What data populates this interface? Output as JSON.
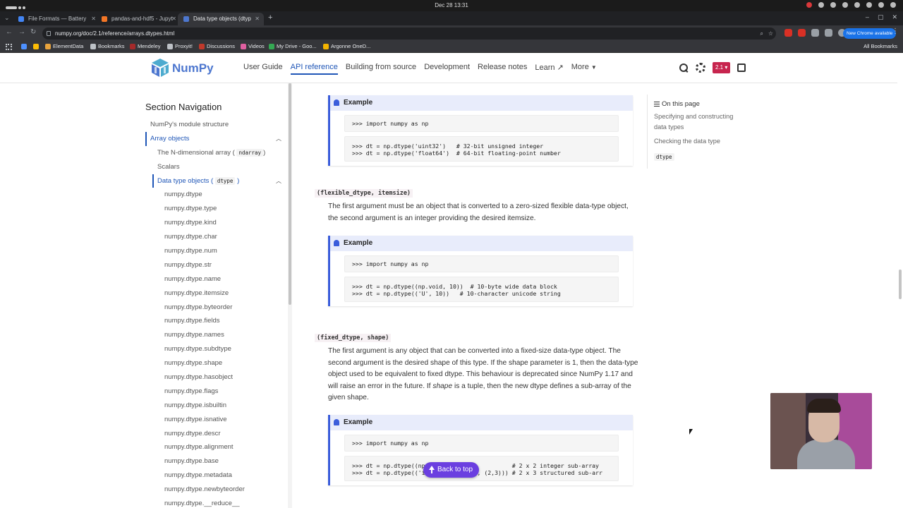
{
  "os": {
    "clock": "Dec 28  13:31"
  },
  "tabs": [
    {
      "title": "File Formats — Battery",
      "fav_color": "#4285f4"
    },
    {
      "title": "pandas-and-hdf5 - Jupyt",
      "fav_color": "#f37626"
    },
    {
      "title": "Data type objects (dtyp",
      "fav_color": "#4d77cf"
    }
  ],
  "toolbar": {
    "url": "numpy.org/doc/2.1/reference/arrays.dtypes.html",
    "update_label": "New Chrome available"
  },
  "bookmarks": {
    "items": [
      {
        "label": "ElementData",
        "color": "#e8a33d"
      },
      {
        "label": "Bookmarks",
        "color": "#bdc1c6"
      },
      {
        "label": "Mendeley",
        "color": "#a52a2a"
      },
      {
        "label": "Proxyit!",
        "color": "#bdc1c6"
      },
      {
        "label": "Discussions",
        "color": "#c0392b"
      },
      {
        "label": "Videos",
        "color": "#e05fa0"
      },
      {
        "label": "My Drive - Goo...",
        "color": "#34a853"
      },
      {
        "label": "Argonne OneD...",
        "color": "#f4b400"
      }
    ],
    "all_label": "All Bookmarks"
  },
  "header": {
    "logo_text": "NumPy",
    "nav": [
      "User Guide",
      "API reference",
      "Building from source",
      "Development",
      "Release notes",
      "Learn",
      "More"
    ],
    "version": "2.1"
  },
  "sidebar": {
    "title": "Section Navigation",
    "items": [
      {
        "label": "NumPy's module structure",
        "level": 1
      },
      {
        "label": "Array objects",
        "level": 1
      },
      {
        "label": "The N-dimensional array (",
        "code": "ndarray",
        "suffix": ")",
        "level": 2
      },
      {
        "label": "Scalars",
        "level": 2
      },
      {
        "label": "Data type objects (",
        "code": "dtype",
        "suffix": ")",
        "level": 2
      },
      {
        "label": "numpy.dtype",
        "level": 3
      },
      {
        "label": "numpy.dtype.type",
        "level": 3
      },
      {
        "label": "numpy.dtype.kind",
        "level": 3
      },
      {
        "label": "numpy.dtype.char",
        "level": 3
      },
      {
        "label": "numpy.dtype.num",
        "level": 3
      },
      {
        "label": "numpy.dtype.str",
        "level": 3
      },
      {
        "label": "numpy.dtype.name",
        "level": 3
      },
      {
        "label": "numpy.dtype.itemsize",
        "level": 3
      },
      {
        "label": "numpy.dtype.byteorder",
        "level": 3
      },
      {
        "label": "numpy.dtype.fields",
        "level": 3
      },
      {
        "label": "numpy.dtype.names",
        "level": 3
      },
      {
        "label": "numpy.dtype.subdtype",
        "level": 3
      },
      {
        "label": "numpy.dtype.shape",
        "level": 3
      },
      {
        "label": "numpy.dtype.hasobject",
        "level": 3
      },
      {
        "label": "numpy.dtype.flags",
        "level": 3
      },
      {
        "label": "numpy.dtype.isbuiltin",
        "level": 3
      },
      {
        "label": "numpy.dtype.isnative",
        "level": 3
      },
      {
        "label": "numpy.dtype.descr",
        "level": 3
      },
      {
        "label": "numpy.dtype.alignment",
        "level": 3
      },
      {
        "label": "numpy.dtype.base",
        "level": 3
      },
      {
        "label": "numpy.dtype.metadata",
        "level": 3
      },
      {
        "label": "numpy.dtype.newbyteorder",
        "level": 3
      },
      {
        "label": "numpy.dtype.__reduce__",
        "level": 3
      }
    ]
  },
  "content": {
    "example1": {
      "title": "Example",
      "code1": ">>> import numpy as np",
      "code2_line1": ">>> dt = np.dtype('uint32')   # 32-bit unsigned integer",
      "code2_line2": ">>> dt = np.dtype('float64')  # 64-bit floating-point number"
    },
    "sig1": "(flexible_dtype, itemsize)",
    "para1": "The first argument must be an object that is converted to a zero-sized flexible data-type object, the second argument is an integer providing the desired itemsize.",
    "example2": {
      "title": "Example",
      "code1": ">>> import numpy as np",
      "code2_line1": ">>> dt = np.dtype((np.void, 10))  # 10-byte wide data block",
      "code2_line2": ">>> dt = np.dtype(('U', 10))   # 10-character unicode string"
    },
    "sig2": "(fixed_dtype, shape)",
    "para2_a": "The first argument is any object that can be converted into a fixed-size data-type object. The second argument is the desired shape of this type. If the shape parameter is 1, then the data-type object used to be equivalent to fixed dtype. This behaviour is deprecated since NumPy 1.17 and will raise an error in the future. If ",
    "para2_em": "shape",
    "para2_b": " is a tuple, then the new dtype defines a sub-array of the given shape.",
    "example3": {
      "title": "Example",
      "code1": ">>> import numpy as np",
      "code2_line1": ">>> dt = np.dtype((np.int32, (2,2)))          # 2 x 2 integer sub-array",
      "code2_line2": ">>> dt = np.dtype(('i4, (2,3)f8, f4', (2,3))) # 2 x 3 structured sub-arr"
    }
  },
  "toc": {
    "title": "On this page",
    "links": [
      "Specifying and constructing data types",
      "Checking the data type"
    ],
    "code": "dtype"
  },
  "back_to_top": "Back to top"
}
